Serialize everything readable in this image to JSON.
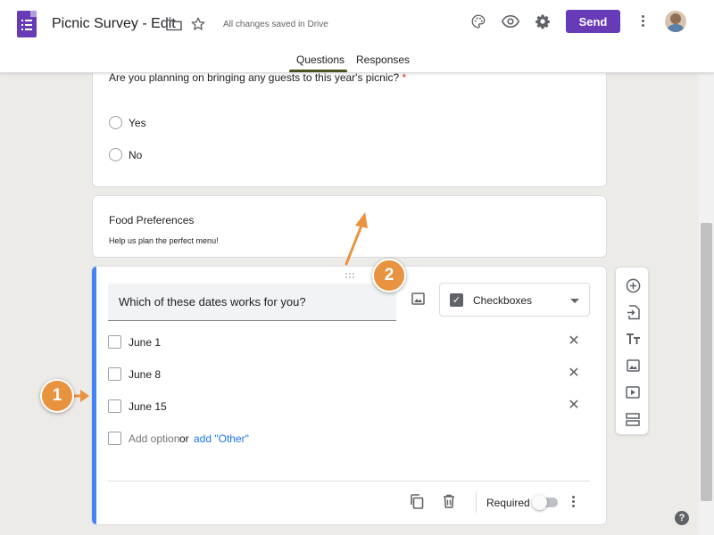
{
  "header": {
    "title": "Picnic Survey - Edit",
    "save_status": "All changes saved in Drive",
    "send_label": "Send",
    "tabs": [
      {
        "label": "Questions",
        "active": true
      },
      {
        "label": "Responses",
        "active": false
      }
    ],
    "icons": [
      "forms-logo-icon",
      "folder-icon",
      "star-icon",
      "palette-icon",
      "eye-icon",
      "gear-icon",
      "more-vert-icon",
      "avatar"
    ]
  },
  "questions": [
    {
      "title": "Are you planning on bringing any guests to this year's picnic?",
      "required_marker": "*",
      "type": "radio",
      "options": [
        "Yes",
        "No"
      ]
    }
  ],
  "section": {
    "title": "Food Preferences",
    "description": "Help us plan the perfect menu!"
  },
  "active_question": {
    "title": "Which of these dates works for you?",
    "type_label": "Checkboxes",
    "options": [
      "June 1",
      "June 8",
      "June 15"
    ],
    "add_option_label": "Add option",
    "or_label": "or",
    "add_other_label": "add \"Other\"",
    "required_label": "Required",
    "required_on": false
  },
  "toolbar": {
    "buttons": [
      "add-question-icon",
      "import-questions-icon",
      "add-title-icon",
      "add-image-icon",
      "add-video-icon",
      "add-section-icon"
    ]
  },
  "callouts": [
    "1",
    "2"
  ],
  "help_label": "?",
  "colors": {
    "accent": "#673ab7",
    "active_bar": "#4285f4",
    "callout": "#e8933f",
    "link": "#1a73e8"
  }
}
